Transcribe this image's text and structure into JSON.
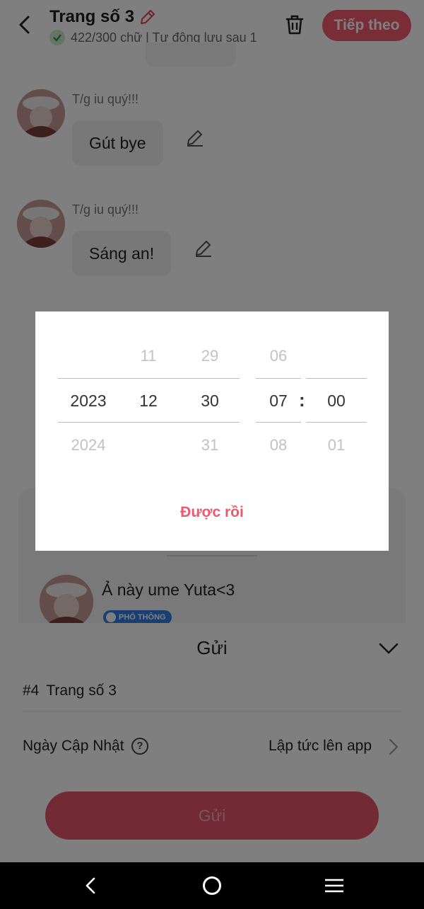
{
  "header": {
    "title": "Trang số 3",
    "subtitle": "422/300 chữ | Tự động lưu sau 1",
    "next_label": "Tiếp theo"
  },
  "messages": [
    {
      "author": "T/g iu quý!!!",
      "text": "Gút bye"
    },
    {
      "author": "T/g iu quý!!!",
      "text": "Sáng an!"
    }
  ],
  "card": {
    "title": "Ả này ume Yuta<3",
    "badge": "PHỔ THÔNG"
  },
  "sheet": {
    "title": "Gửi",
    "chapter_number": "#4",
    "chapter_name": "Trang số 3",
    "date_label": "Ngày Cập Nhật",
    "help_glyph": "?",
    "date_value": "Lập tức lên app",
    "send_label": "Gửi"
  },
  "picker": {
    "year": [
      "",
      "2023",
      "2024"
    ],
    "month": [
      "11",
      "12",
      ""
    ],
    "day": [
      "29",
      "30",
      "31"
    ],
    "hour": [
      "06",
      "07",
      "08"
    ],
    "minute": [
      "",
      "00",
      "01"
    ],
    "separator": ":",
    "ok_label": "Được rồi"
  },
  "colors": {
    "accent": "#ec5a70",
    "overlay": "rgba(0,0,0,0.5)",
    "badge": "#2f7ee6"
  }
}
